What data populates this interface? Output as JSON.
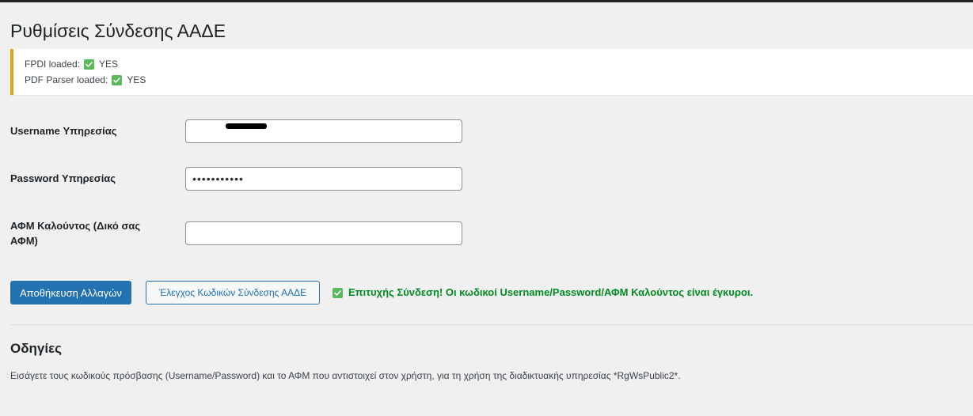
{
  "page": {
    "title": "Ρυθμίσεις Σύνδεσης ΑΑΔΕ"
  },
  "notice": {
    "fpdi_label": "FPDI loaded:",
    "fpdi_value": "YES",
    "parser_label": "PDF Parser loaded:",
    "parser_value": "YES",
    "border_color": "#dba617"
  },
  "form": {
    "username_label": "Username Υπηρεσίας",
    "username_value": "",
    "password_label": "Password Υπηρεσίας",
    "password_value": "•••••••••••",
    "afm_label": "ΑΦΜ Καλούντος (Δικό σας ΑΦΜ)",
    "afm_value": ""
  },
  "actions": {
    "save_label": "Αποθήκευση Αλλαγών",
    "test_label": "Έλεγχος Κωδικών Σύνδεσης ΑΑΔΕ",
    "success_message": "Επιτυχής Σύνδεση! Οι κωδικοί Username/Password/ΑΦΜ Καλούντος είναι έγκυροι."
  },
  "instructions": {
    "title": "Οδηγίες",
    "text": "Εισάγετε τους κωδικούς πρόσβασης (Username/Password) και το ΑΦΜ που αντιστοιχεί στον χρήστη, για τη χρήση της διαδικτυακής υπηρεσίας *RgWsPublic2*."
  },
  "colors": {
    "primary": "#2271b1",
    "success": "#008a20",
    "check_icon_bg": "#5cb85c",
    "warning_border": "#dba617"
  },
  "icons": {
    "status_check": "check-mark-icon"
  }
}
